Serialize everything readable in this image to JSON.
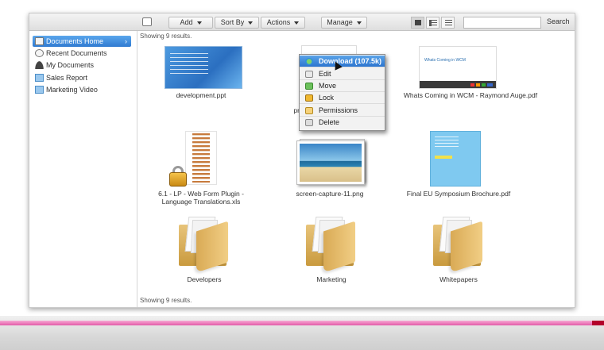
{
  "toolbar": {
    "add_label": "Add",
    "sort_label": "Sort By",
    "actions_label": "Actions",
    "manage_label": "Manage",
    "search_value": "",
    "search_label": "Search"
  },
  "sidebar": {
    "items": [
      {
        "label": "Documents Home",
        "icon": "home-icon",
        "active": true
      },
      {
        "label": "Recent Documents",
        "icon": "clock-icon",
        "active": false
      },
      {
        "label": "My Documents",
        "icon": "user-icon",
        "active": false
      },
      {
        "label": "Sales Report",
        "icon": "documents-icon",
        "active": false
      },
      {
        "label": "Marketing Video",
        "icon": "documents-icon",
        "active": false
      }
    ]
  },
  "results_top": "Showing 9 results.",
  "results_bottom": "Showing 9 results.",
  "files": [
    {
      "name": "development.ppt",
      "type": "ppt"
    },
    {
      "name": "pr",
      "type": "partial"
    },
    {
      "name": "Whats Coming in WCM - Raymond Auge.pdf",
      "type": "pdf"
    },
    {
      "name": "6.1 - LP - Web Form Plugin - Language Translations.xls",
      "type": "xls"
    },
    {
      "name": "screen-capture-11.png",
      "type": "png"
    },
    {
      "name": "Final EU Symposium Brochure.pdf",
      "type": "pdf"
    },
    {
      "name": "Developers",
      "type": "folder"
    },
    {
      "name": "Marketing",
      "type": "folder"
    },
    {
      "name": "Whitepapers",
      "type": "folder"
    }
  ],
  "thumb_text": {
    "pdf_title": "Whats Coming in WCM"
  },
  "context_menu": {
    "items": [
      {
        "label": "Download (107.5k)",
        "icon": "download-icon",
        "highlighted": true
      },
      {
        "label": "Edit",
        "icon": "edit-icon"
      },
      {
        "label": "Move",
        "icon": "move-icon"
      },
      {
        "label": "Lock",
        "icon": "lock-icon"
      },
      {
        "label": "Permissions",
        "icon": "permissions-icon"
      },
      {
        "label": "Delete",
        "icon": "delete-icon"
      }
    ]
  },
  "colors": {
    "accent": "#2f7ad1",
    "folder": "#e8c47a",
    "pink_band": "#e25aa8"
  }
}
